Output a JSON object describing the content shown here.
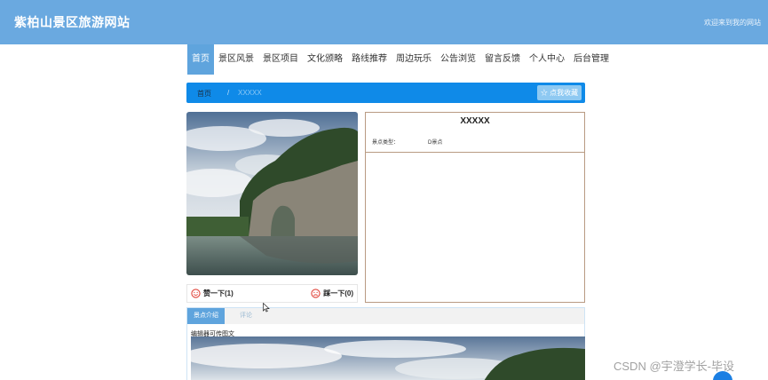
{
  "header": {
    "site_title": "紫柏山景区旅游网站",
    "welcome": "欢迎来到我的网站"
  },
  "nav": {
    "items": [
      "首页",
      "景区风景",
      "景区项目",
      "文化颁略",
      "路线推荐",
      "周边玩乐",
      "公告浏览",
      "留言反馈",
      "个人中心",
      "后台管理"
    ],
    "active_index": 0
  },
  "breadcrumb": {
    "home": "首页",
    "separator": "/",
    "current": "XXXXX",
    "favorite_button": "☆ 点我收藏"
  },
  "votes": {
    "like_label": "赞一下(1)",
    "dislike_label": "踩一下(0)"
  },
  "detail": {
    "title": "XXXXX",
    "type_label": "景点类型：",
    "type_value": "D景点"
  },
  "tabs": {
    "items": [
      "景点介绍",
      "评论"
    ],
    "active_index": 0,
    "editor_note": "编辑器可传图文"
  },
  "overlay": {
    "watermark": "CSDN @宇澄学长-毕设"
  },
  "colors": {
    "header_bg": "#6aa9e0",
    "nav_active": "#5fa4dd",
    "breadcrumb_bg": "#0f8ae8",
    "infobox_border": "#b99b83",
    "vote_icon": "#e0443a"
  }
}
